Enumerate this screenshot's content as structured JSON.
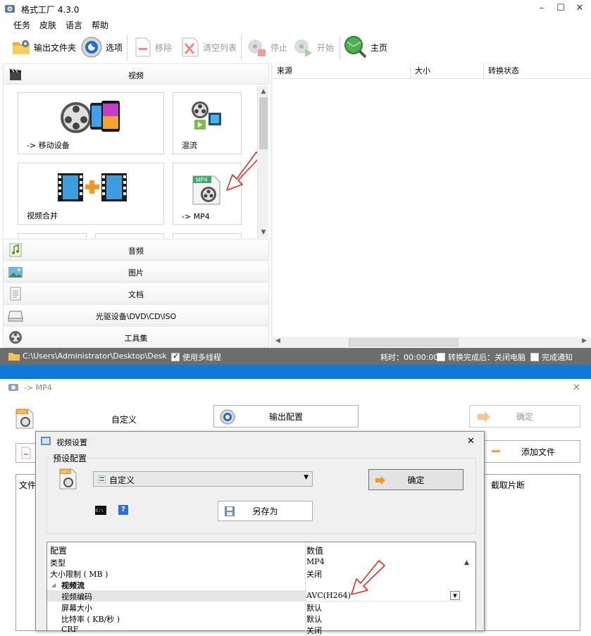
{
  "main_window": {
    "title": "格式工厂 4.3.0",
    "controls": {
      "minimize": "–",
      "maximize": "☐",
      "close": "✕"
    },
    "menu": [
      "任务",
      "皮肤",
      "语言",
      "帮助"
    ],
    "toolbar": {
      "output_folder": "输出文件夹",
      "options": "选项",
      "remove": "移除",
      "clear_list": "清空列表",
      "stop": "停止",
      "start": "开始",
      "home": "主页"
    },
    "categories": {
      "video": "视频",
      "audio": "音频",
      "image": "图片",
      "document": "文档",
      "optical": "光驱设备\\DVD\\CD\\ISO",
      "tools": "工具集"
    },
    "tiles": {
      "mobile": "-> 移动设备",
      "mux": "混流",
      "merge": "视频合并",
      "mp4": "-> MP4"
    },
    "list_columns": [
      "来源",
      "大小",
      "转换状态"
    ],
    "status": {
      "path": "C:\\Users\\Administrator\\Desktop\\Desk",
      "multithread": "使用多线程",
      "elapsed": "耗时：00:00:00",
      "after_done": "转换完成后：关闭电脑",
      "notify": "完成通知"
    }
  },
  "format_window": {
    "title": "-> MP4",
    "close": "✕",
    "custom_label": "自定义",
    "output_config": "输出配置",
    "ok": "确定",
    "add_file": "添加文件",
    "col_file": "文件",
    "col_clip": "截取片断"
  },
  "video_settings": {
    "title": "视频设置",
    "close": "✕",
    "preset_group": "预设配置",
    "preset_value": "自定义",
    "ok": "确定",
    "save_as": "另存为",
    "help": "?",
    "grid_header": {
      "name": "配置",
      "value": "数值"
    },
    "rows": [
      {
        "name": "类型",
        "value": "MP4"
      },
      {
        "name": "大小限制 ( MB )",
        "value": "关闭"
      },
      {
        "name": "视频流",
        "value": ""
      },
      {
        "name": "视频编码",
        "value": "AVC(H264)"
      },
      {
        "name": "屏幕大小",
        "value": "默认"
      },
      {
        "name": "比特率 ( KB/秒 )",
        "value": "默认"
      },
      {
        "name": "CRF",
        "value": "关闭"
      }
    ]
  },
  "colors": {
    "status_bar": "#6d6d6d",
    "accent_blue": "#0e7ad7",
    "arrow_red": "#e0302a"
  }
}
